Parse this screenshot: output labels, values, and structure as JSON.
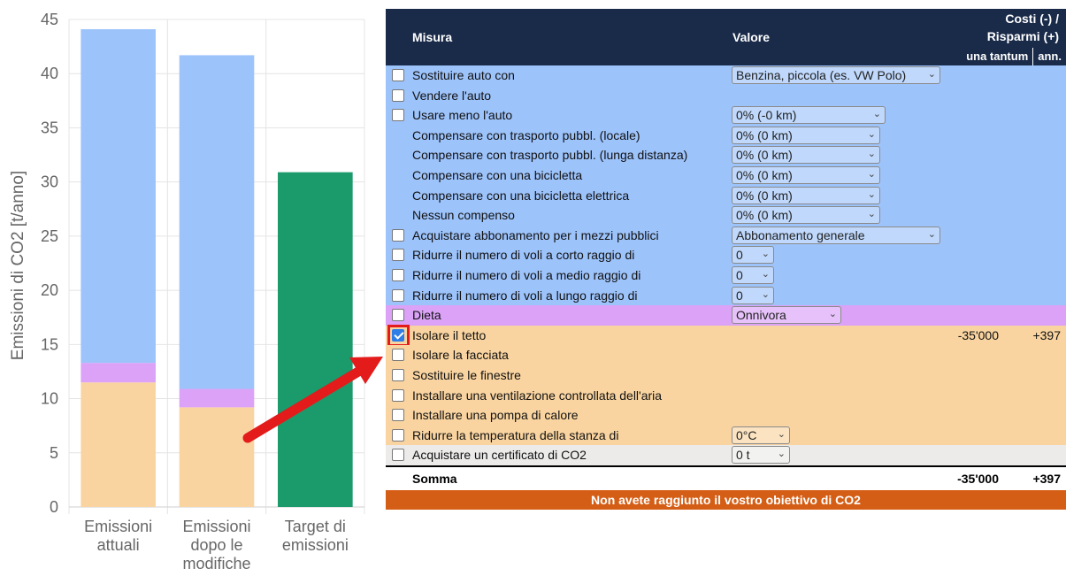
{
  "chart_data": {
    "type": "bar",
    "stacked": true,
    "ylabel": "Emissioni di CO2 [t/anno]",
    "ylim": [
      0,
      45
    ],
    "yticks": [
      0,
      5,
      10,
      15,
      20,
      25,
      30,
      35,
      40,
      45
    ],
    "grid": true,
    "categories": [
      [
        "Emissioni",
        "attuali"
      ],
      [
        "Emissioni",
        "dopo le",
        "modifiche"
      ],
      [
        "Target di",
        "emissioni"
      ]
    ],
    "series": [
      {
        "color": "#f9d4a0",
        "values": [
          11.5,
          9.2,
          0
        ]
      },
      {
        "color": "#dba2f7",
        "values": [
          1.8,
          1.7,
          0
        ]
      },
      {
        "color": "#9dc3fb",
        "values": [
          30.8,
          30.8,
          0
        ]
      },
      {
        "color": "#1b9a6b",
        "values": [
          0,
          0,
          30.9
        ]
      }
    ]
  },
  "table": {
    "header": {
      "misura": "Misura",
      "valore": "Valore",
      "costi_line1": "Costi (-) /",
      "costi_line2": "Risparmi (+)",
      "once": "una tantum",
      "annual": "ann."
    },
    "rows": [
      {
        "group": "transport",
        "checkbox": true,
        "label": "Sostituire auto con",
        "select": "Benzina, piccola (es. VW Polo)",
        "w": 236
      },
      {
        "group": "transport",
        "checkbox": true,
        "label": "Vendere l'auto"
      },
      {
        "group": "transport",
        "checkbox": true,
        "label": "Usare meno l'auto",
        "select": "0% (-0 km)",
        "w": 174
      },
      {
        "group": "transport",
        "checkbox": false,
        "label": "Compensare con trasporto pubbl. (locale)",
        "select": "0% (0 km)",
        "w": 168
      },
      {
        "group": "transport",
        "checkbox": false,
        "label": "Compensare con trasporto pubbl. (lunga distanza)",
        "select": "0% (0 km)",
        "w": 168
      },
      {
        "group": "transport",
        "checkbox": false,
        "label": "Compensare con una bicicletta",
        "select": "0% (0 km)",
        "w": 168
      },
      {
        "group": "transport",
        "checkbox": false,
        "label": "Compensare con una bicicletta elettrica",
        "select": "0% (0 km)",
        "w": 168
      },
      {
        "group": "transport",
        "checkbox": false,
        "label": "Nessun compenso",
        "select": "0% (0 km)",
        "w": 168
      },
      {
        "group": "transport",
        "checkbox": true,
        "label": "Acquistare abbonamento per i mezzi pubblici",
        "select": "Abbonamento generale",
        "w": 236
      },
      {
        "group": "transport",
        "checkbox": true,
        "label": "Ridurre il numero di voli a corto raggio di",
        "select": "0",
        "w": 48
      },
      {
        "group": "transport",
        "checkbox": true,
        "label": "Ridurre il numero di voli a medio raggio di",
        "select": "0",
        "w": 48
      },
      {
        "group": "transport",
        "checkbox": true,
        "label": "Ridurre il numero di voli a lungo raggio di",
        "select": "0",
        "w": 48
      },
      {
        "group": "diet",
        "checkbox": true,
        "label": "Dieta",
        "select": "Onnivora",
        "w": 124
      },
      {
        "group": "home",
        "checkbox": true,
        "checked": true,
        "highlight": true,
        "label": "Isolare il tetto",
        "once": "-35'000",
        "annual": "+397"
      },
      {
        "group": "home",
        "checkbox": true,
        "label": "Isolare la facciata"
      },
      {
        "group": "home",
        "checkbox": true,
        "label": "Sostituire le finestre"
      },
      {
        "group": "home",
        "checkbox": true,
        "label": "Installare una ventilazione controllata dell'aria"
      },
      {
        "group": "home",
        "checkbox": true,
        "label": "Installare una pompa di calore"
      },
      {
        "group": "home",
        "checkbox": true,
        "label": "Ridurre la temperatura della stanza di",
        "select": "0°C",
        "w": 66
      },
      {
        "group": "cert",
        "checkbox": true,
        "label": "Acquistare un certificato di CO2",
        "select": "0 t",
        "w": 66
      }
    ],
    "sum": {
      "label": "Somma",
      "once": "-35'000",
      "annual": "+397"
    },
    "banner": "Non avete raggiunto il vostro obiettivo di CO2"
  }
}
